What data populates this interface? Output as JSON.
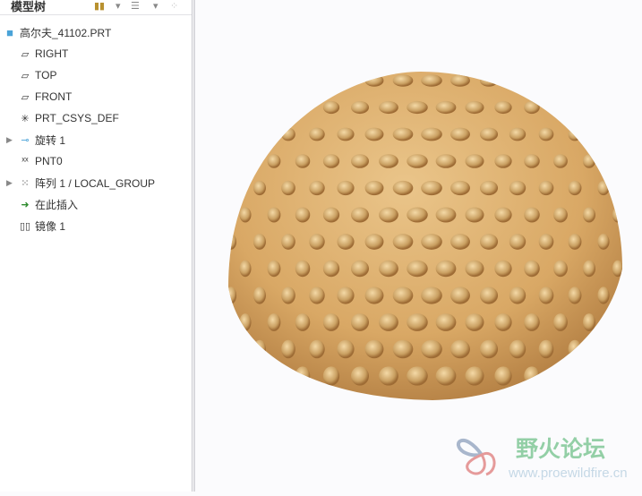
{
  "tree": {
    "title": "模型树",
    "root": "高尔夫_41102.PRT",
    "items": [
      {
        "label": "RIGHT",
        "icon": "datum-plane-icon"
      },
      {
        "label": "TOP",
        "icon": "datum-plane-icon"
      },
      {
        "label": "FRONT",
        "icon": "datum-plane-icon"
      },
      {
        "label": "PRT_CSYS_DEF",
        "icon": "coordinate-system-icon"
      },
      {
        "label": "旋转 1",
        "icon": "revolve-icon",
        "expandable": true
      },
      {
        "label": "PNT0",
        "icon": "datum-point-icon"
      },
      {
        "label": "阵列 1 / LOCAL_GROUP",
        "icon": "pattern-icon",
        "expandable": true
      },
      {
        "label": "在此插入",
        "icon": "insert-here-arrow-icon"
      },
      {
        "label": "镜像 1",
        "icon": "mirror-icon"
      }
    ]
  },
  "watermark": {
    "title": "野火论坛",
    "url": "www.proewildfire.cn"
  },
  "colors": {
    "part": "#d9a865",
    "accent": "#2e8b2e"
  }
}
